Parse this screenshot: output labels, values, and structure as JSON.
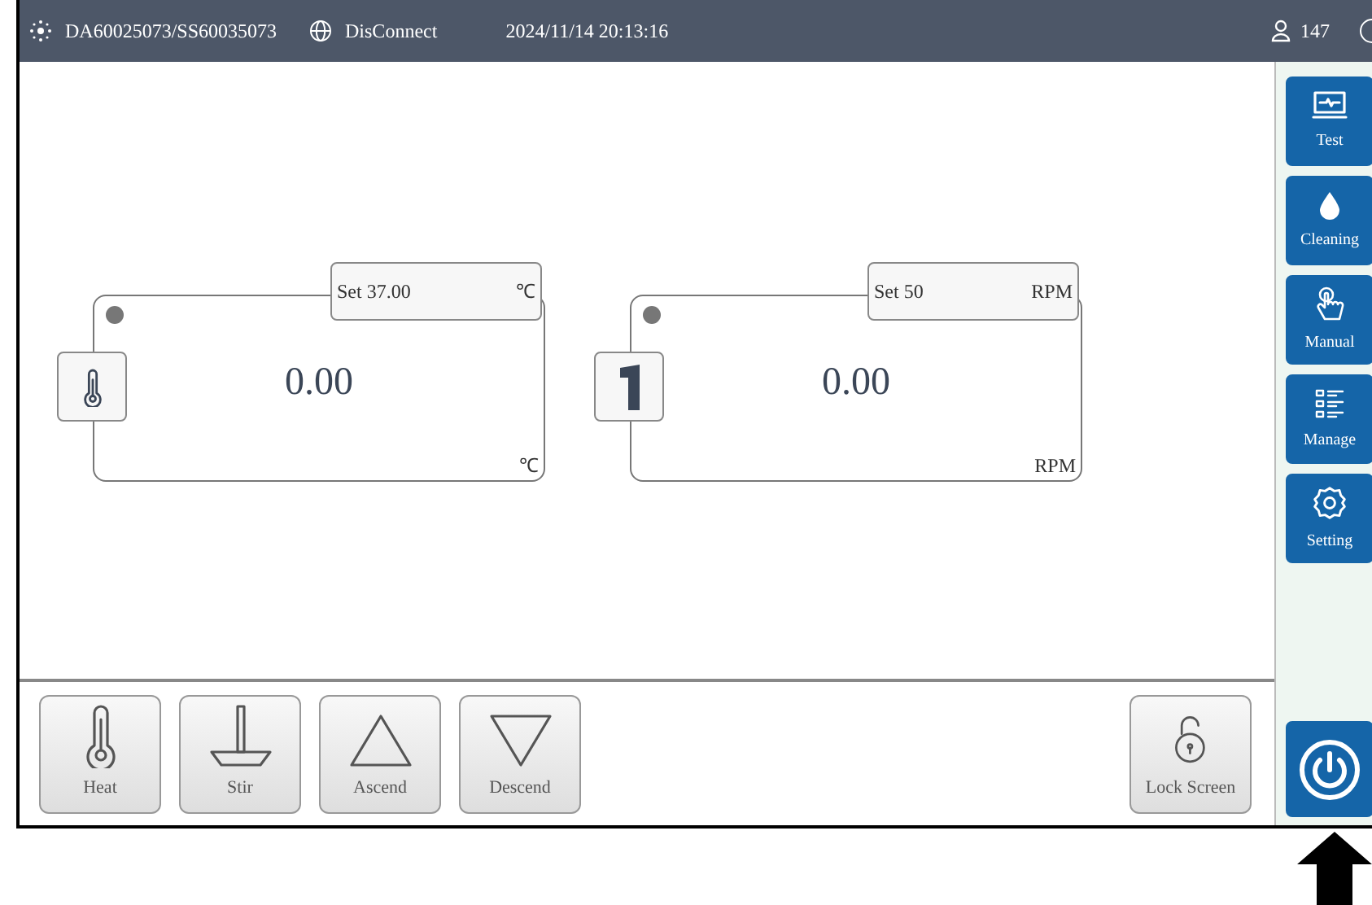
{
  "header": {
    "device": "DA60025073/SS60035073",
    "connection": "DisConnect",
    "datetime": "2024/11/14 20:13:16",
    "user": "147"
  },
  "cards": [
    {
      "kind": "heat",
      "setpoint": "Set 37.00",
      "set_unit": "℃",
      "value": "0.00",
      "unit": "℃"
    },
    {
      "kind": "stir",
      "setpoint": "Set 50",
      "set_unit": "RPM",
      "value": "0.00",
      "unit": "RPM"
    }
  ],
  "sidebar": {
    "items": [
      {
        "kind": "test",
        "label": "Test"
      },
      {
        "kind": "cleaning",
        "label": "Cleaning"
      },
      {
        "kind": "manual",
        "label": "Manual"
      },
      {
        "kind": "manage",
        "label": "Manage"
      },
      {
        "kind": "setting",
        "label": "Setting"
      }
    ]
  },
  "toolbar": {
    "left": [
      {
        "kind": "heat",
        "label": "Heat"
      },
      {
        "kind": "stir",
        "label": "Stir"
      },
      {
        "kind": "ascend",
        "label": "Ascend"
      },
      {
        "kind": "descend",
        "label": "Descend"
      }
    ],
    "right": [
      {
        "kind": "lock",
        "label": "Lock Screen"
      }
    ]
  }
}
